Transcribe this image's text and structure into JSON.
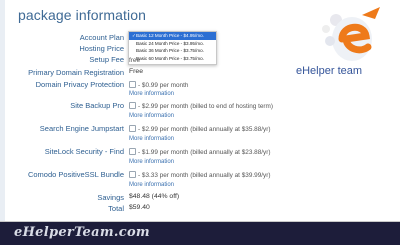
{
  "title": "package information",
  "labels": {
    "account_plan": "Account Plan",
    "hosting_price": "Hosting Price",
    "setup_fee": "Setup Fee",
    "primary_domain": "Primary Domain Registration",
    "domain_privacy": "Domain Privacy Protection",
    "site_backup": "Site Backup Pro",
    "seo": "Search Engine Jumpstart",
    "sitelock": "SiteLock Security - Find",
    "ssl": "Comodo PositiveSSL Bundle",
    "savings": "Savings",
    "total": "Total"
  },
  "plan_dropdown": {
    "options": [
      "Basic 12 Month Price - $4.95/mo.",
      "Basic 24 Month Price - $3.95/mo.",
      "Basic 36 Month Price - $3.75/mo.",
      "Basic 60 Month Price - $3.75/mo."
    ],
    "selected_index": 0,
    "check": "✓"
  },
  "values": {
    "setup_fee": "free",
    "primary_domain": "Free",
    "domain_privacy": "- $0.99 per month",
    "site_backup": "- $2.99 per month (billed to end of hosting term)",
    "seo": "- $2.99 per month (billed annually at $35.88/yr)",
    "sitelock": "- $1.99 per month (billed annually at $23.88/yr)",
    "ssl": "- $3.33 per month (billed annually at $39.99/yr)",
    "savings": "$48.48 (44% off)",
    "total": "$59.40"
  },
  "more_information": "More information",
  "logo": {
    "caption": "eHelper team"
  },
  "footer_brand": "eHelperTeam.com",
  "colors": {
    "label_blue": "#2e5f91",
    "link_blue": "#3c72b0",
    "selected_option": "#2c6fd3",
    "footer_band": "#1d1d3a"
  }
}
